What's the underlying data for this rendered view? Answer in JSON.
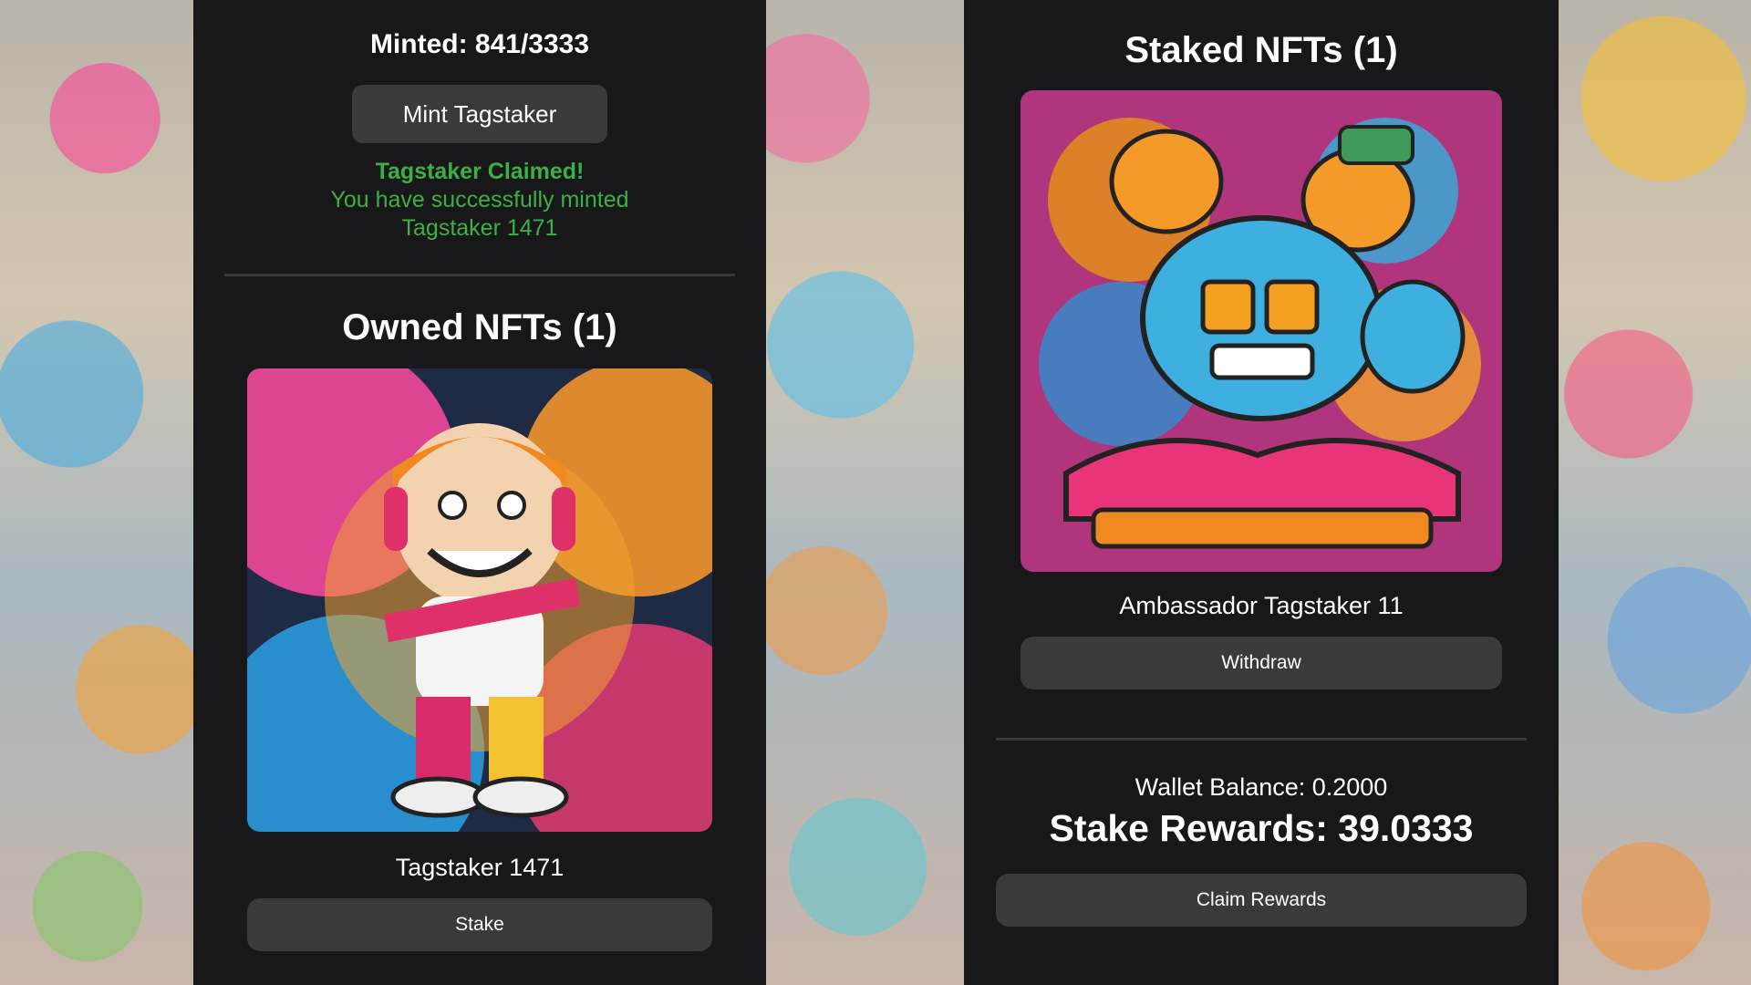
{
  "mint": {
    "minted_text": "Minted: 841/3333",
    "mint_button": "Mint Tagstaker",
    "success_title": "Tagstaker Claimed!",
    "success_line1": "You have successfully minted",
    "success_line2": "Tagstaker 1471"
  },
  "owned": {
    "title": "Owned NFTs (1)",
    "items": [
      {
        "name": "Tagstaker 1471",
        "button": "Stake"
      }
    ]
  },
  "staked": {
    "title": "Staked NFTs (1)",
    "items": [
      {
        "name": "Ambassador Tagstaker 11",
        "button": "Withdraw"
      }
    ]
  },
  "wallet": {
    "balance_text": "Wallet Balance: 0.2000",
    "rewards_text": "Stake Rewards: 39.0333",
    "claim_button": "Claim Rewards"
  },
  "colors": {
    "panel": "#18181a",
    "button": "#3a3a3c",
    "success": "#3cb043"
  }
}
